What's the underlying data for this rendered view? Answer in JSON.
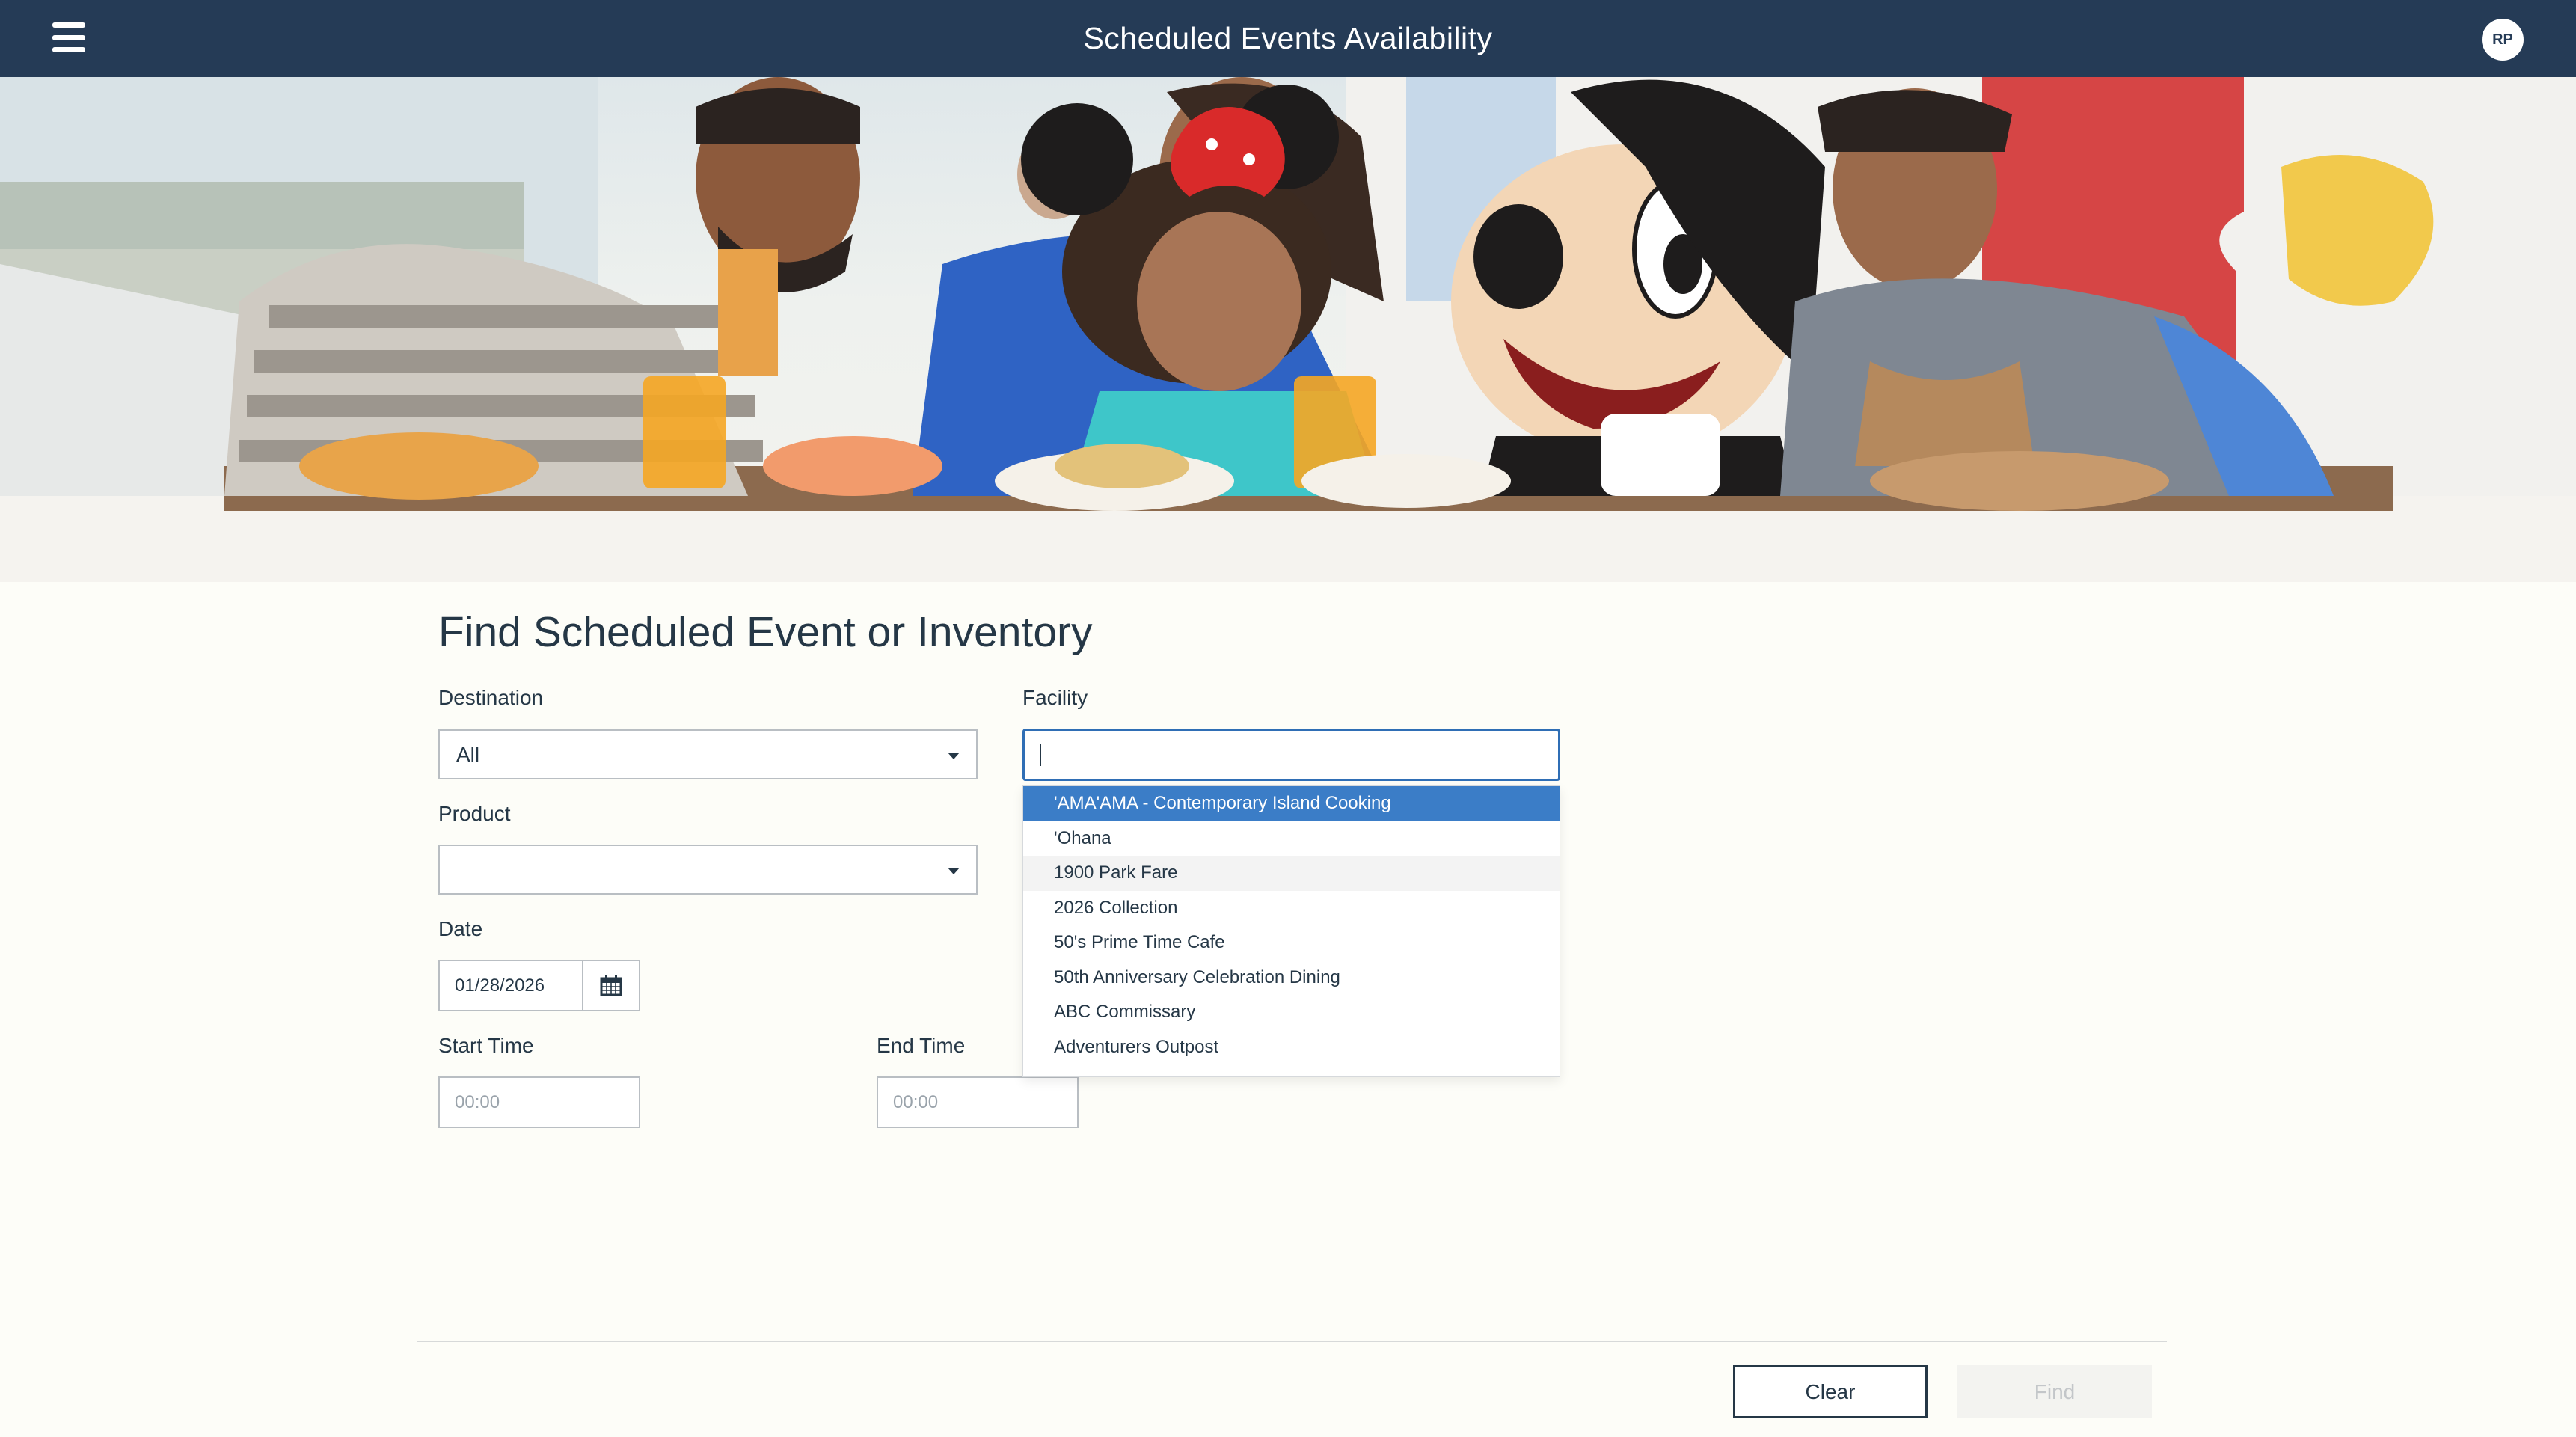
{
  "header": {
    "title": "Scheduled Events Availability",
    "avatar_initials": "RP"
  },
  "form": {
    "title": "Find Scheduled Event or Inventory",
    "destination": {
      "label": "Destination",
      "value": "All"
    },
    "facility": {
      "label": "Facility",
      "value": ""
    },
    "product": {
      "label": "Product",
      "value": ""
    },
    "date": {
      "label": "Date",
      "value": "01/28/2026"
    },
    "start_time": {
      "label": "Start Time",
      "placeholder": "00:00"
    },
    "end_time": {
      "label": "End Time",
      "placeholder": "00:00"
    }
  },
  "facility_dropdown": {
    "items": [
      "'AMA'AMA - Contemporary Island Cooking",
      "'Ohana",
      "1900 Park Fare",
      "2026 Collection",
      "50's Prime Time Cafe",
      "50th Anniversary Celebration Dining",
      "ABC Commissary",
      "Adventurers Outpost"
    ],
    "selected_index": 0,
    "hovered_index": 2
  },
  "footer": {
    "clear_label": "Clear",
    "find_label": "Find"
  },
  "colors": {
    "header_bg": "#253b56",
    "accent": "#3b7dc7",
    "text": "#253746"
  },
  "icons": {
    "menu": "hamburger-menu-icon",
    "calendar": "calendar-icon",
    "dropdown": "caret-down-icon"
  }
}
